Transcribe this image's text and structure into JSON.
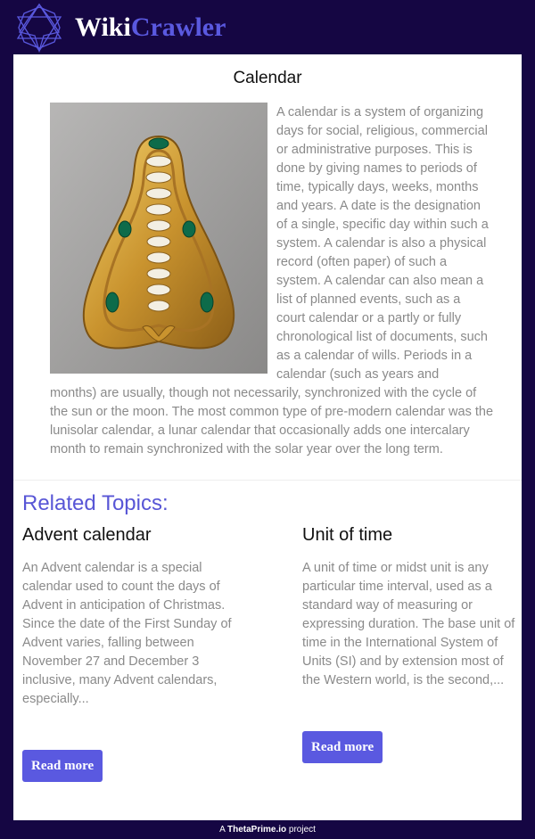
{
  "header": {
    "brand_part1": "Wiki",
    "brand_part2": "Crawler",
    "logo_icon": "star-outline-icon"
  },
  "article": {
    "title": "Calendar",
    "image_alt": "Ornate gilded calendar",
    "text_lines_top": [
      "A calendar is a system of organizing",
      "days for social, religious, commercial",
      "or administrative purposes. This is",
      "done by giving names to periods of",
      "time, typically days, weeks, months",
      "and years. A date is the designation",
      "of a single, specific day within such a",
      "system. A calendar is also a physical",
      "record (often paper) of such a",
      "system. A calendar can also mean a",
      "list of planned events, such as a",
      "court calendar or a partly or fully",
      "chronological list of documents, such",
      "as a calendar of wills. Periods in a",
      "calendar (such as years and"
    ],
    "text_lines_bottom": [
      "months) are usually, though not necessarily, synchronized with the cycle of",
      "the sun or the moon. The most common type of pre-modern calendar was the",
      "lunisolar calendar, a lunar calendar that occasionally adds one intercalary",
      "month to remain synchronized with the solar year over the long term."
    ]
  },
  "related": {
    "heading": "Related Topics:",
    "items": [
      {
        "title": "Advent calendar",
        "lines": [
          "An Advent calendar is a special",
          "calendar used to count the days of",
          "Advent in anticipation of Christmas.",
          "Since the date of the First Sunday of",
          "Advent varies, falling between",
          "November 27 and December 3",
          "inclusive, many Advent calendars,",
          "especially..."
        ],
        "button": "Read more"
      },
      {
        "title": "Unit of time",
        "lines": [
          "A unit of time or midst unit is any",
          "particular time interval, used as a",
          "standard way of measuring or",
          "expressing duration. The base unit of",
          "time in the International System of",
          "Units (SI) and by extension most of",
          "the Western world, is the second,..."
        ],
        "button": "Read more"
      }
    ]
  },
  "footer": {
    "prefix": "A ",
    "brand": "ThetaPrime.io",
    "suffix": " project"
  },
  "colors": {
    "background": "#150643",
    "accent": "#5a59e0",
    "text_muted": "#8a8a8a"
  }
}
